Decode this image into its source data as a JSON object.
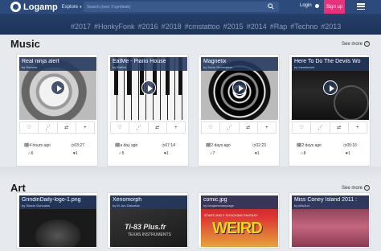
{
  "app": {
    "name": "Logamp",
    "explore_label": "Explore"
  },
  "search": {
    "placeholder": "Search (over 3 symbols)"
  },
  "header": {
    "login_label": "Login",
    "signup_label": "Sign up"
  },
  "tags": [
    "#2017",
    "#HonkyFonk",
    "#2016",
    "#2018",
    "#cmstattoo",
    "#2015",
    "#2014",
    "#Rap",
    "#Techno",
    "#2013"
  ],
  "sections": {
    "music": {
      "title": "Music",
      "see_more": "See more",
      "cards": [
        {
          "title": "Real ninja alert",
          "by": "by   Ramcro",
          "time": "4 hours ago",
          "duration": "03:27",
          "plays": "6",
          "likes": "1"
        },
        {
          "title": "EatMe - Piano House",
          "by": "by   EatMe",
          "time": "a day ago",
          "duration": "07:14",
          "plays": "5",
          "likes": "1"
        },
        {
          "title": "Magnetix",
          "by": "by   Sonic Recreation",
          "time": "2 days ago",
          "duration": "02:23",
          "plays": "7",
          "likes": "1"
        },
        {
          "title": "Here To Do The Devils Wo",
          "by": "by   Insanimant",
          "time": "2 days ago",
          "duration": "05:16",
          "plays": "8",
          "likes": "1"
        }
      ]
    },
    "art": {
      "title": "Art",
      "see_more": "See more",
      "cards": [
        {
          "title": "GrindinDaily-logo-1.png",
          "by": "by   Shane Gonzales"
        },
        {
          "title": "Xenomorph",
          "by": "by   M. Ars Disturbia",
          "art_text": "Ti-83 Plus.fr",
          "art_sub": "TEXAS INSTRUMENTS"
        },
        {
          "title": "comic.jpg",
          "by": "by   benjamenkeycage",
          "art_text": "WEIRD",
          "art_sub": "STARTLING !! SHOCKING FANTASY"
        },
        {
          "title": "Miss Coney Island 2011 :",
          "by": "by   kills3urt"
        }
      ]
    }
  },
  "card_actions": {
    "add_label": "+"
  },
  "colors": {
    "nav": "#2c4a7c",
    "signup": "#e8327a",
    "hero": "#1e3357"
  }
}
